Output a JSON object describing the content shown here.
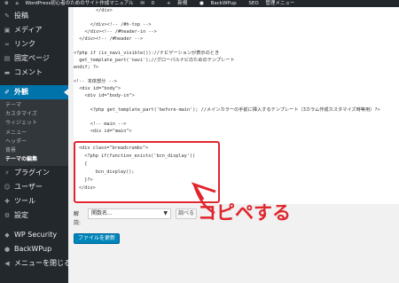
{
  "adminbar": {
    "site_title": "WordPress初心者のためのサイト作成マニュアル",
    "comments_count": "0",
    "new_label": "新規",
    "backwpup_label": "BackWPup",
    "seo_label": "SEO",
    "manage_menu_label": "管理メニュー"
  },
  "sidebar": {
    "items": [
      {
        "label": "投稿",
        "icon": "pin-icon"
      },
      {
        "label": "メディア",
        "icon": "media-icon"
      },
      {
        "label": "リンク",
        "icon": "link-icon"
      },
      {
        "label": "固定ページ",
        "icon": "page-icon"
      },
      {
        "label": "コメント",
        "icon": "comment-icon"
      }
    ],
    "active": {
      "label": "外観",
      "icon": "paintbrush-icon"
    },
    "submenu": [
      "テーマ",
      "カスタマイズ",
      "ウィジェット",
      "メニュー",
      "ヘッダー",
      "背景",
      "テーマの編集"
    ],
    "submenu_current": 6,
    "items_after": [
      {
        "label": "プラグイン",
        "icon": "plugin-icon"
      },
      {
        "label": "ユーザー",
        "icon": "user-icon"
      },
      {
        "label": "ツール",
        "icon": "tools-icon"
      },
      {
        "label": "設定",
        "icon": "settings-icon"
      }
    ],
    "extra": [
      {
        "label": "WP Security",
        "icon": "shield-icon"
      },
      {
        "label": "BackWPup",
        "icon": "backwpup-icon"
      },
      {
        "label": "メニューを閉じる",
        "icon": "collapse-icon"
      }
    ]
  },
  "code_lines": [
    "        </div>",
    "",
    "      </div><!-- /#h-top -->",
    "    </div><!-- /#header-in -->",
    "  </div><!-- /#header -->",
    "",
    "<?php if (is_navi_visible())://ナビゲーションが表示のとき",
    "  get_template_part('navi');//グローバルナビのためのテンプレート",
    "endif; ?>",
    "",
    "<!-- 本体部分 -->",
    "  <div id=\"body\">",
    "    <div id=\"body-in\">",
    "",
    "      <?php get_template_part('before-main'); //メインカラーの手前に挿入するテンプレート（3カラム作成カスタマイズ時等用）?>",
    "",
    "      <!-- main -->",
    "      <div id=\"main\">",
    "",
    "<div class=\"breadcrumbs\">",
    "  <?php if(function_exists('bcn_display'))",
    "  {",
    "      bcn_display();",
    "  }?>",
    "</div>"
  ],
  "editor_bottom": {
    "docs_label": "解説:",
    "docs_select_value": "関数名...",
    "lookup_button": "調べる",
    "save_button": "ファイルを更新"
  },
  "annotation": {
    "callout_text": "コピペする",
    "accent_color": "#e0262d"
  }
}
